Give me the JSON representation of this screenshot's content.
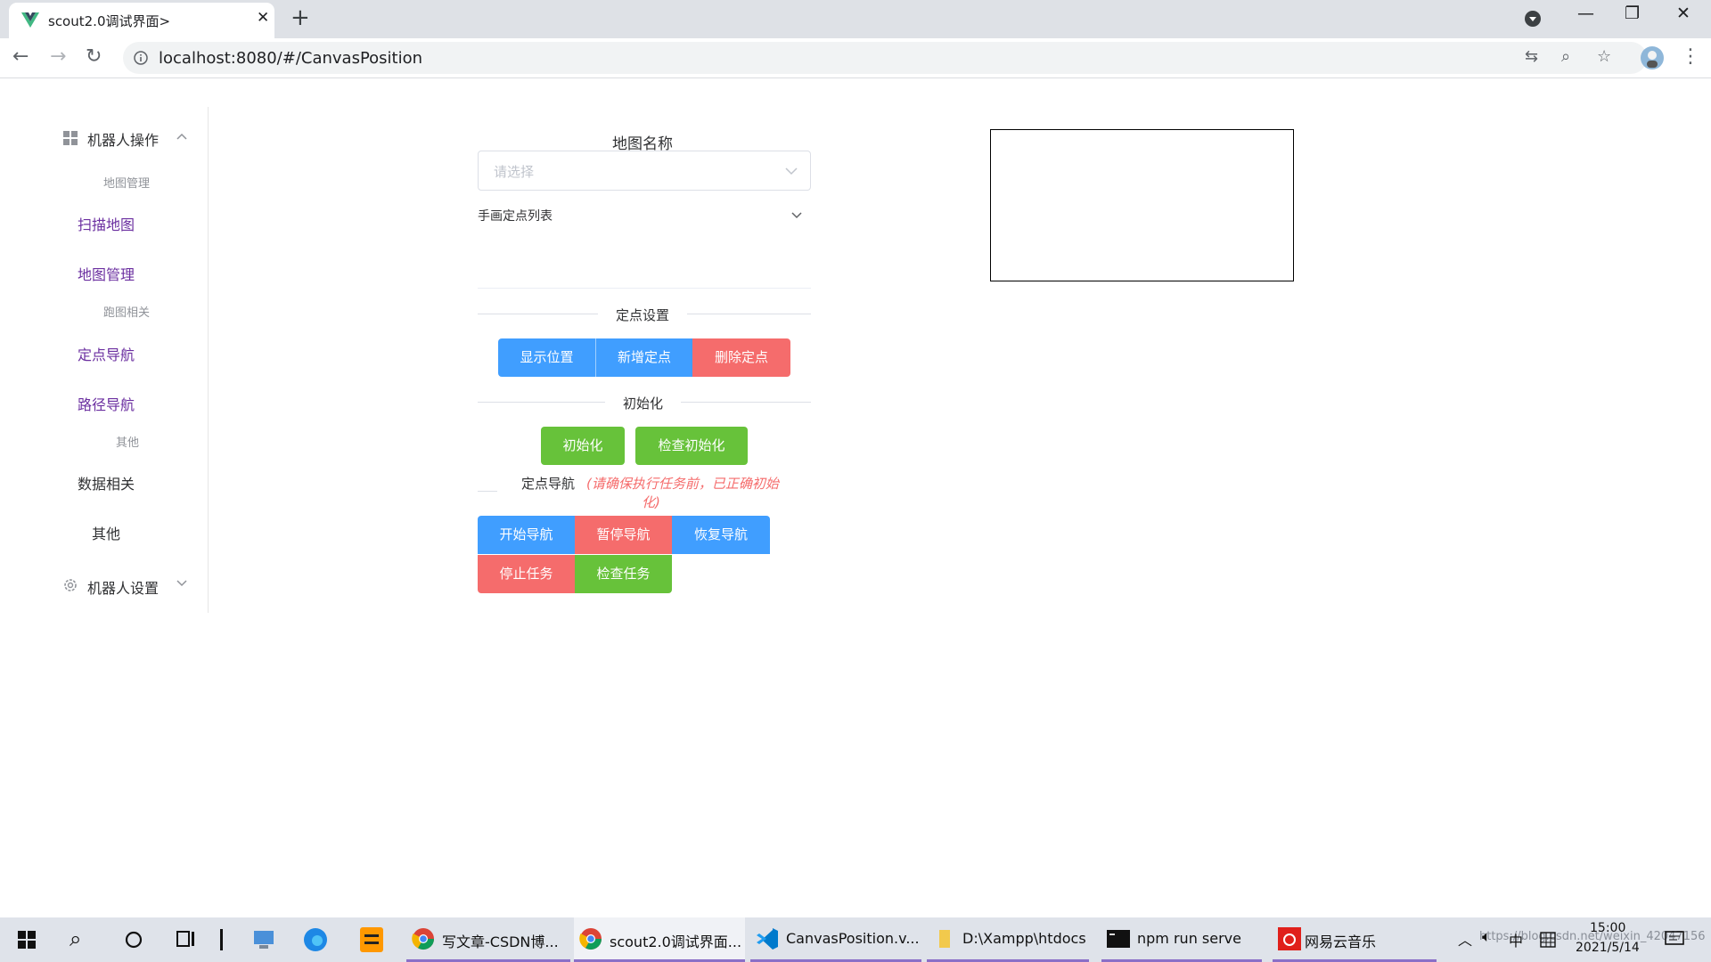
{
  "browser": {
    "tab_title": "scout2.0调试界面>",
    "tab_close": "✕",
    "new_tab": "+",
    "url": "localhost:8080/#/CanvasPosition",
    "win_min": "—",
    "win_max": "❐",
    "win_close": "✕"
  },
  "sidebar": {
    "robot_ops": "机器人操作",
    "group_map_mgmt": "地图管理",
    "scan_map": "扫描地图",
    "map_mgmt": "地图管理",
    "group_run": "跑图相关",
    "point_nav": "定点导航",
    "path_nav": "路径导航",
    "group_other": "其他",
    "data": "数据相关",
    "other": "其他",
    "robot_settings": "机器人设置"
  },
  "main": {
    "map_name_label": "地图名称",
    "select_placeholder": "请选择",
    "collapse_title": "手画定点列表",
    "divider_points": "定点设置",
    "btn_show_pos": "显示位置",
    "btn_add_point": "新增定点",
    "btn_delete_point": "删除定点",
    "divider_init": "初始化",
    "btn_init": "初始化",
    "btn_check_init": "检查初始化",
    "nav_title": "定点导航",
    "nav_note_line1": "(请确保执行任务前，已正确初始",
    "nav_note_line2": "化)",
    "btn_start_nav": "开始导航",
    "btn_pause_nav": "暂停导航",
    "btn_resume_nav": "恢复导航",
    "btn_stop_task": "停止任务",
    "btn_check_task": "检查任务"
  },
  "taskbar": {
    "apps": [
      {
        "label": "写文章-CSDN博..."
      },
      {
        "label": "scout2.0调试界面..."
      },
      {
        "label": "CanvasPosition.v..."
      },
      {
        "label": "D:\\Xampp\\htdocs"
      },
      {
        "label": "npm run serve"
      },
      {
        "label": "网易云音乐"
      }
    ],
    "ime": "中",
    "time": "15:00",
    "date": "2021/5/14",
    "watermark": "https://blog.csdn.net/weixin_42047156"
  },
  "colors": {
    "primary": "#409eff",
    "danger": "#f56c6c",
    "success": "#67c23a",
    "menu_active": "#6b2fa0"
  }
}
